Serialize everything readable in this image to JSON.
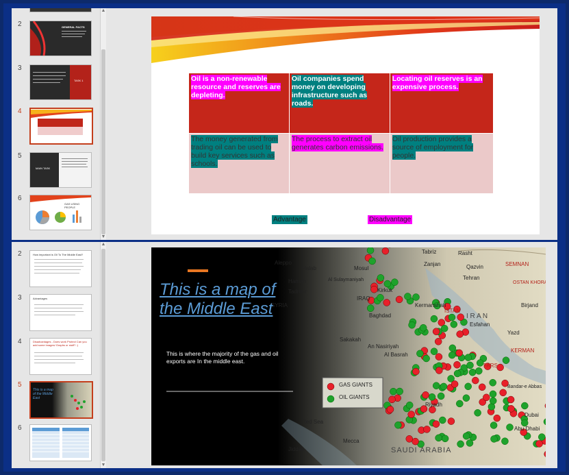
{
  "top_window": {
    "thumbnails": [
      {
        "num": "2",
        "title": "GENERAL FACTS"
      },
      {
        "num": "3",
        "title": "TASK 1"
      },
      {
        "num": "4",
        "title": ""
      },
      {
        "num": "5",
        "title": "MAIN TASK"
      },
      {
        "num": "6",
        "title": "GAS USING PEOPLE"
      }
    ],
    "slide": {
      "cells": [
        [
          "Oil is a non-renewable resource and reserves are depleting.",
          "Oil companies spend money on developing infrastructure such as roads.",
          "Locating oil reserves is an expensive process."
        ],
        [
          "The money generated from trading oil can be used to build key services such as schools.",
          "The process to extract oil generates carbon emissions.",
          "Oil production provides a source of employment for people."
        ]
      ],
      "key_advantage": "Advantage",
      "key_disadvantage": "Disadvantage"
    }
  },
  "bottom_window": {
    "thumbnails": [
      {
        "num": "2",
        "title": "How important is Oil To The Middle East?"
      },
      {
        "num": "3",
        "title": "Advantages"
      },
      {
        "num": "4",
        "title": "Disadvantages - Does work Protect Can you add some images/ Graphs or stuff? :)"
      },
      {
        "num": "5",
        "title": "This is a map of the Middle East"
      },
      {
        "num": "6",
        "title": ""
      }
    ],
    "slide": {
      "title": "This is a map of the Middle East",
      "body": "This is where the majority of the gas and oil exports are In the middle east.",
      "legend": [
        "GAS GIANTS",
        "OIL GIANTS"
      ],
      "places": [
        "Tabriz",
        "Rasht",
        "Zanjan",
        "Qazvin",
        "SEMNAN",
        "Tehran",
        "Aleppo",
        "Halab",
        "Mosul",
        "Al Sulaymaniyah",
        "Hamah",
        "Tadmur",
        "SYRIA",
        "Kirkuk",
        "IRAQ",
        "Kermanshah",
        "OSTAN KHORASAN",
        "Birjand",
        "ISTAN",
        "Baghdad",
        "I R A N",
        "Esfahan",
        "Yazd",
        "An Nasiriyah",
        "Sakakah",
        "Al Basrah",
        "KERMAN",
        "FARS",
        "Bandar-e Abbas",
        "Riyadh",
        "Dubai",
        "Abu Dhabi",
        "Red Sea",
        "Mecca",
        "Jiddah",
        "SAUDI ARABIA"
      ],
      "colors": {
        "gas": "#e8202a",
        "oil": "#1fa22c"
      }
    }
  }
}
